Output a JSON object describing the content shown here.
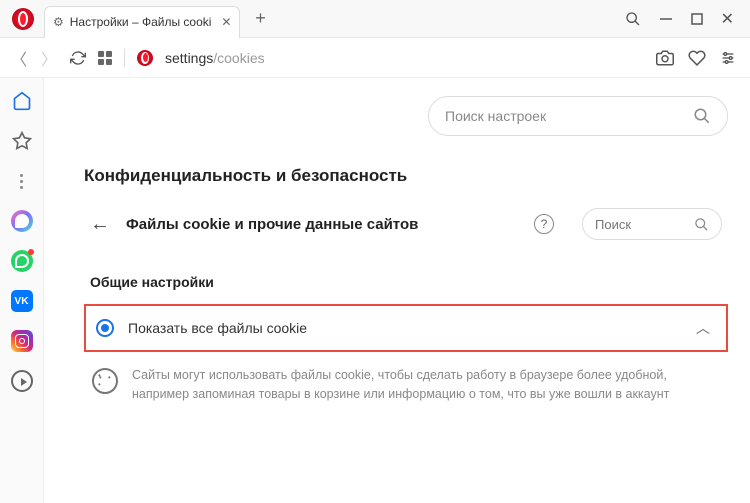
{
  "tab": {
    "title": "Настройки – Файлы cooki"
  },
  "url": {
    "base": "settings",
    "path": "/cookies"
  },
  "search": {
    "main_placeholder": "Поиск настроек",
    "sub_placeholder": "Поиск"
  },
  "section": {
    "title": "Конфиденциальность и безопасность"
  },
  "subsection": {
    "title": "Файлы cookie и прочие данные сайтов"
  },
  "group": {
    "title": "Общие настройки"
  },
  "option": {
    "label": "Показать все файлы cookie",
    "description": "Сайты могут использовать файлы cookie, чтобы сделать работу в браузере более удобной, например запоминая товары в корзине или информацию о том, что вы уже вошли в аккаунт"
  },
  "sidebar": {
    "vk_label": "VK"
  }
}
